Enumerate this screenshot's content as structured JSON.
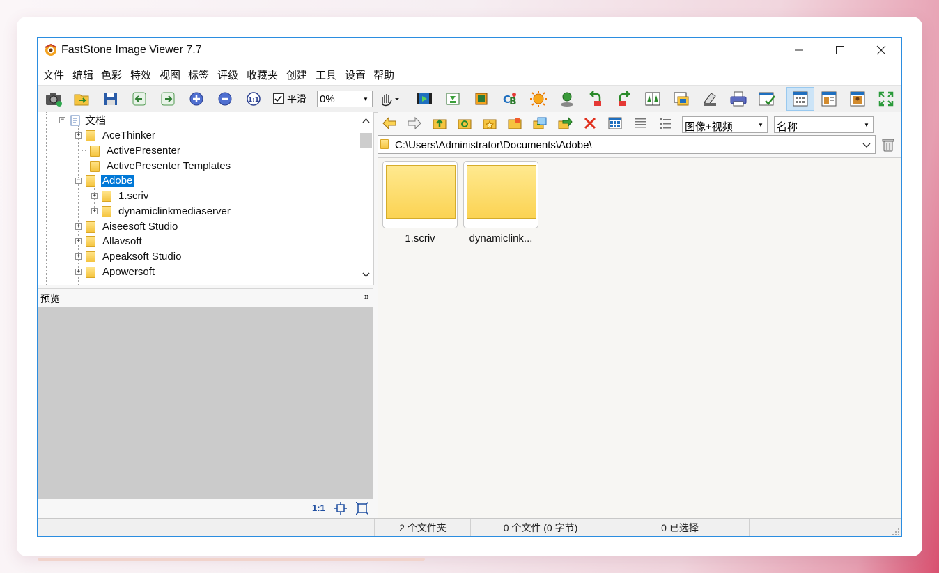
{
  "window": {
    "title": "FastStone Image Viewer 7.7"
  },
  "menu": {
    "items": [
      "文件",
      "编辑",
      "色彩",
      "特效",
      "视图",
      "标签",
      "评级",
      "收藏夹",
      "创建",
      "工具",
      "设置",
      "帮助"
    ]
  },
  "toolbar": {
    "smooth_label": "平滑",
    "smooth_checked": true,
    "zoom_value": "0%"
  },
  "tree": {
    "root_label": "文档",
    "items": [
      {
        "label": "AceThinker",
        "expandable": true
      },
      {
        "label": "ActivePresenter",
        "expandable": false
      },
      {
        "label": "ActivePresenter Templates",
        "expandable": false
      },
      {
        "label": "Adobe",
        "expandable": true,
        "expanded": true,
        "selected": true
      },
      {
        "label": "1.scriv",
        "expandable": true,
        "child": true
      },
      {
        "label": "dynamiclinkmediaserver",
        "expandable": true,
        "child": true
      },
      {
        "label": "Aiseesoft Studio",
        "expandable": true
      },
      {
        "label": "Allavsoft",
        "expandable": true
      },
      {
        "label": "Apeaksoft Studio",
        "expandable": true
      },
      {
        "label": "Apowersoft",
        "expandable": true
      }
    ]
  },
  "preview": {
    "title": "预览",
    "ratio_label": "1:1"
  },
  "browser": {
    "filter_value": "图像+视频",
    "sort_value": "名称",
    "path": "C:\\Users\\Administrator\\Documents\\Adobe\\",
    "thumbnails": [
      {
        "label": "1.scriv"
      },
      {
        "label": "dynamiclink..."
      }
    ]
  },
  "status": {
    "folders": "2 个文件夹",
    "files": "0 个文件 (0 字节)",
    "selected": "0 已选择"
  },
  "colors": {
    "accent": "#0078d7",
    "folder": "#fbd353"
  }
}
